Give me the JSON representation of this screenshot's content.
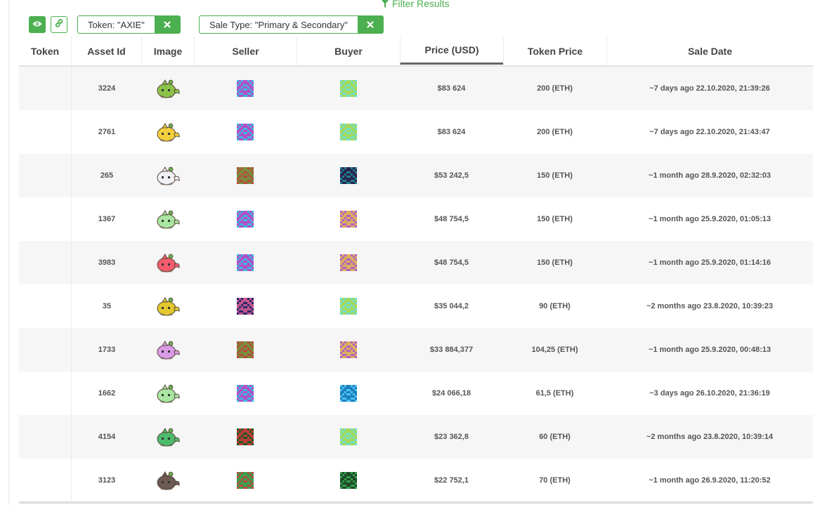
{
  "filter_results": {
    "label": "Filter Results",
    "color": "#4caf50"
  },
  "toolbar": {
    "view_icon": "eye-icon",
    "link_icon": "link-icon",
    "chips": [
      {
        "label": "Token: \"AXIE\"",
        "remove_icon": "close-icon"
      },
      {
        "label": "Sale Type: \"Primary & Secondary\"",
        "remove_icon": "close-icon"
      }
    ]
  },
  "table": {
    "columns": [
      "Token",
      "Asset Id",
      "Image",
      "Seller",
      "Buyer",
      "Price (USD)",
      "Token Price",
      "Sale Date"
    ],
    "sorted_column": "Price (USD)",
    "rows": [
      {
        "asset_id": "3224",
        "axie_color": "#8bc34a",
        "seller": "magenta-blue",
        "buyer": "teal-green",
        "price_usd": "$83 624",
        "token_price": "200 (ETH)",
        "sale_date": "~7 days ago 22.10.2020, 21:39:26"
      },
      {
        "asset_id": "2761",
        "axie_color": "#f4d03f",
        "seller": "magenta-blue",
        "buyer": "teal-green",
        "price_usd": "$83 624",
        "token_price": "200 (ETH)",
        "sale_date": "~7 days ago 22.10.2020, 21:43:47"
      },
      {
        "asset_id": "265",
        "axie_color": "#f0f0f5",
        "seller": "red-olive",
        "buyer": "navy-teal",
        "price_usd": "$53 242,5",
        "token_price": "150 (ETH)",
        "sale_date": "~1 month ago 28.9.2020, 02:32:03"
      },
      {
        "asset_id": "1367",
        "axie_color": "#a8e6a1",
        "seller": "magenta-blue",
        "buyer": "purple-gold",
        "price_usd": "$48 754,5",
        "token_price": "150 (ETH)",
        "sale_date": "~1 month ago 25.9.2020, 01:05:13"
      },
      {
        "asset_id": "3983",
        "axie_color": "#f25c6e",
        "seller": "magenta-blue",
        "buyer": "purple-gold",
        "price_usd": "$48 754,5",
        "token_price": "150 (ETH)",
        "sale_date": "~1 month ago 25.9.2020, 01:14:16"
      },
      {
        "asset_id": "35",
        "axie_color": "#e2c72e",
        "seller": "navy-pink",
        "buyer": "teal-green",
        "price_usd": "$35 044,2",
        "token_price": "90 (ETH)",
        "sale_date": "~2 months ago 23.8.2020, 10:39:23"
      },
      {
        "asset_id": "1733",
        "axie_color": "#d99ae6",
        "seller": "red-olive",
        "buyer": "purple-gold",
        "price_usd": "$33 884,377",
        "token_price": "104,25 (ETH)",
        "sale_date": "~1 month ago 25.9.2020, 00:48:13"
      },
      {
        "asset_id": "1662",
        "axie_color": "#a8e6a1",
        "seller": "magenta-blue",
        "buyer": "sky-blue",
        "price_usd": "$24 066,18",
        "token_price": "61,5 (ETH)",
        "sale_date": "~3 days ago 26.10.2020, 21:36:19"
      },
      {
        "asset_id": "4154",
        "axie_color": "#4cbb6c",
        "seller": "dark-green-red",
        "buyer": "teal-green",
        "price_usd": "$23 362,8",
        "token_price": "60 (ETH)",
        "sale_date": "~2 months ago 23.8.2020, 10:39:14"
      },
      {
        "asset_id": "3123",
        "axie_color": "#6d5a55",
        "seller": "red-green",
        "buyer": "green-dark",
        "price_usd": "$22 752,1",
        "token_price": "70 (ETH)",
        "sale_date": "~1 month ago 26.9.2020, 11:20:52"
      }
    ]
  }
}
